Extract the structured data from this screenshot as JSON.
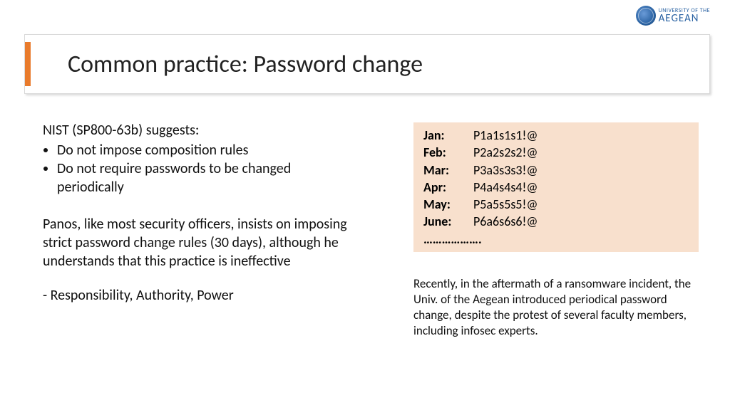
{
  "logo": {
    "line1": "UNIVERSITY OF THE",
    "line2": "AEGEAN"
  },
  "title": "Common practice: Password change",
  "left": {
    "intro": "NIST (SP800-63b) suggests:",
    "bullets": [
      "Do not impose composition rules",
      "Do not require passwords to be changed periodically"
    ],
    "paragraph": "Panos, like most security officers, insists on imposing strict password change rules (30 days), although he understands that this practice is ineffective",
    "footer": "- Responsibility, Authority, Power"
  },
  "passwords": {
    "rows": [
      {
        "month": "Jan:",
        "value": "P1a1s1s1!@"
      },
      {
        "month": "Feb:",
        "value": "P2a2s2s2!@"
      },
      {
        "month": "Mar:",
        "value": "P3a3s3s3!@"
      },
      {
        "month": "Apr:",
        "value": "P4a4s4s4!@"
      },
      {
        "month": "May:",
        "value": "P5a5s5s5!@"
      },
      {
        "month": "June:",
        "value": "P6a6s6s6!@"
      }
    ],
    "ellipsis": "………………."
  },
  "note": "Recently, in the aftermath of a ransomware incident, the Univ. of the Aegean introduced periodical password change, despite the protest of several faculty members, including infosec experts."
}
